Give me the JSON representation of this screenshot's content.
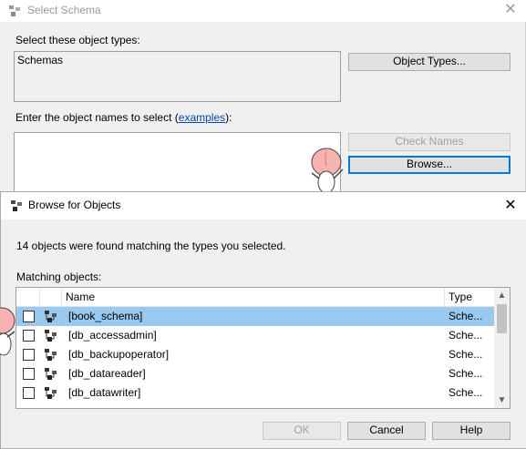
{
  "select_schema": {
    "title": "Select Schema",
    "object_types_label": "Select these object types:",
    "object_types_value": "Schemas",
    "object_types_button": "Object Types...",
    "names_label_prefix": "Enter the object names to select (",
    "names_label_link": "examples",
    "names_label_suffix": "):",
    "names_value": "",
    "check_names_button": "Check Names",
    "browse_button": "Browse..."
  },
  "browse_dialog": {
    "title": "Browse for Objects",
    "found_message": "14 objects were found matching the types you selected.",
    "matching_label": "Matching objects:",
    "columns": {
      "name": "Name",
      "type": "Type"
    },
    "rows": [
      {
        "name": "[book_schema]",
        "type": "Sche...",
        "selected": true
      },
      {
        "name": "[db_accessadmin]",
        "type": "Sche...",
        "selected": false
      },
      {
        "name": "[db_backupoperator]",
        "type": "Sche...",
        "selected": false
      },
      {
        "name": "[db_datareader]",
        "type": "Sche...",
        "selected": false
      },
      {
        "name": "[db_datawriter]",
        "type": "Sche...",
        "selected": false
      }
    ],
    "ok_button": "OK",
    "cancel_button": "Cancel",
    "help_button": "Help"
  },
  "icons": {
    "title": "users-icon",
    "close": "close-icon",
    "schema": "schema-icon",
    "scroll_up": "chevron-up-icon",
    "scroll_down": "chevron-down-icon"
  },
  "colors": {
    "dialog_bg": "#f0f0f0",
    "selection": "#99c9ef",
    "focus_border": "#0078d7",
    "link": "#0645ad"
  }
}
